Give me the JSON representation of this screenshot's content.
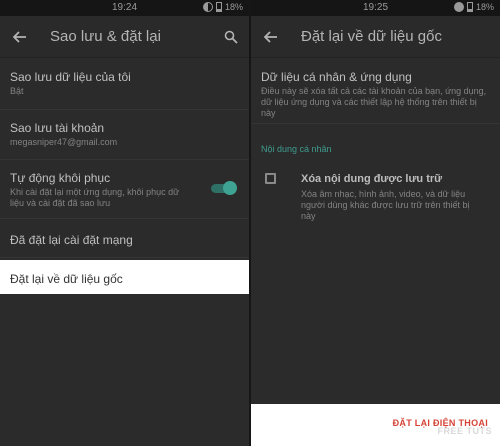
{
  "left": {
    "status": {
      "time": "19:24",
      "battery": "18%"
    },
    "title": "Sao lưu & đặt lại",
    "items": [
      {
        "title": "Sao lưu dữ liệu của tôi",
        "subtitle": "Bật"
      },
      {
        "title": "Sao lưu tài khoản",
        "subtitle": "megasniper47@gmail.com"
      },
      {
        "title": "Tự động khôi phục",
        "subtitle": "Khi cài đặt lại một ứng dụng, khôi phục dữ liệu và cài đặt đã sao lưu"
      },
      {
        "title": "Đã đặt lại cài đặt mạng",
        "subtitle": ""
      }
    ],
    "highlighted_item": "Đặt lại về dữ liệu gốc"
  },
  "right": {
    "status": {
      "time": "19:25",
      "battery": "18%"
    },
    "title": "Đặt lại về dữ liệu gốc",
    "personal": {
      "title": "Dữ liệu cá nhân & ứng dụng",
      "subtitle": "Điều này sẽ xóa tất cả các tài khoản của bạn, ứng dụng, dữ liệu ứng dụng và các thiết lập hệ thống trên thiết bị này"
    },
    "section_label": "Nội dung cá nhân",
    "erase": {
      "title": "Xóa nội dung được lưu trữ",
      "subtitle": "Xóa âm nhạc, hình ảnh, video, và dữ liệu người dùng khác được lưu trữ trên thiết bị này"
    },
    "reset_button": "ĐẶT LẠI ĐIỆN THOẠI",
    "watermark": "FREE TUTS"
  },
  "colors": {
    "accent": "#3ea393",
    "danger": "#d64235",
    "background": "#2b2b2b"
  },
  "icons": [
    "back-arrow-icon",
    "search-icon",
    "toggle-switch",
    "checkbox"
  ]
}
